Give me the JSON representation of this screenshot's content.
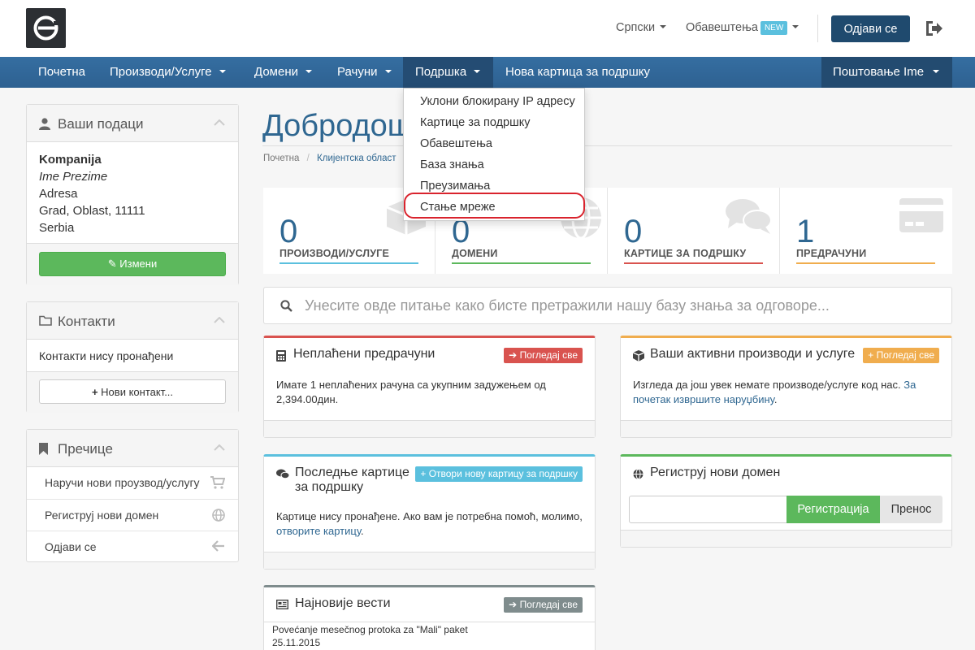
{
  "header": {
    "language": "Српски",
    "notifications": "Обавештења",
    "new_badge": "NEW",
    "logout": "Одјави се"
  },
  "nav": {
    "home": "Почетна",
    "products": "Производи/Услуге",
    "domains": "Домени",
    "invoices": "Рачуни",
    "support": "Подршка",
    "new_ticket": "Нова картица за подршку",
    "user": "Поштовање Ime"
  },
  "support_menu": {
    "items": [
      "Уклони блокирану IP адресу",
      "Картице за подршку",
      "Обавештења",
      "База знања",
      "Преузимања",
      "Стање мреже"
    ],
    "highlighted_index": 5
  },
  "sidebar": {
    "your_info": {
      "title": "Ваши подаци",
      "company": "Kompanija",
      "name": "Ime Prezime",
      "address": "Adresa",
      "city": "Grad, Oblast, 11111",
      "country": "Serbia",
      "edit": "Измени"
    },
    "contacts": {
      "title": "Контакти",
      "empty": "Контакти нису пронађени",
      "new": "Нови контакт..."
    },
    "shortcuts": {
      "title": "Пречице",
      "order": "Наручи нови проузвод/услугу",
      "register": "Региструј нови домен",
      "logout": "Одјави се"
    }
  },
  "main": {
    "welcome": "Добродош",
    "breadcrumb": {
      "home": "Почетна",
      "sep": "/",
      "current": "Клијентска област"
    },
    "tiles": [
      {
        "value": "0",
        "label": "ПРОИЗВОДИ/УСЛУГЕ",
        "color": "#5bc0de"
      },
      {
        "value": "0",
        "label": "ДОМЕНИ",
        "color": "#5cb85c"
      },
      {
        "value": "0",
        "label": "КАРТИЦЕ ЗА ПОДРШКУ",
        "color": "#d9534f"
      },
      {
        "value": "1",
        "label": "ПРЕДРАЧУНИ",
        "color": "#f0ad4e"
      }
    ],
    "search_placeholder": "Унесите овде питање како бисте претражили нашу базу знања за одговоре...",
    "unpaid": {
      "title": "Неплаћени предрачуни",
      "badge": "Погледај све",
      "body": "Имате 1 неплаћених рачуна са укупним задужењем од 2,394.00дин."
    },
    "active": {
      "title": "Ваши активни производи и услуге",
      "badge": "Погледај све",
      "body": "Изгледа да још увек немате производе/услуге код нас.",
      "link": "За почетак извршите наруџбину"
    },
    "tickets": {
      "title_line1": "Последње картице",
      "title_line2": "за подршку",
      "badge": "Отвори нову картицу за подршку",
      "body": "Картице нису пронађене. Ако вам је потребна помоћ, молимо,",
      "link": "отворите картицу"
    },
    "register_domain": {
      "title": "Региструј нови домен",
      "register": "Регистрација",
      "transfer": "Пренос"
    },
    "news": {
      "title": "Најновије вести",
      "badge": "Погледај све",
      "item_title": "Povećanje mesečnog protoka za \"Mali\" paket",
      "item_date": "25.11.2015"
    }
  },
  "colors": {
    "nav": "#2e6191",
    "primary": "#2f6791",
    "danger": "#d9534f",
    "warning": "#f0ad4e",
    "info": "#5bc0de",
    "success": "#5cb85c",
    "muted": "#7f8c8d"
  }
}
